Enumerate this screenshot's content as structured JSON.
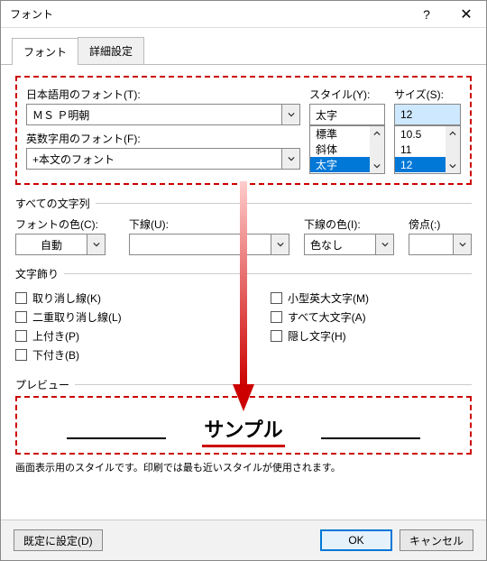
{
  "window": {
    "title": "フォント"
  },
  "tabs": {
    "font": "フォント",
    "advanced": "詳細設定"
  },
  "labels": {
    "jpFont": "日本語用のフォント(T):",
    "enFont": "英数字用のフォント(F):",
    "style": "スタイル(Y):",
    "size": "サイズ(S):"
  },
  "jpFont": {
    "value": "ＭＳ Ｐ明朝"
  },
  "enFont": {
    "value": "+本文のフォント"
  },
  "style": {
    "value": "太字",
    "options": [
      "標準",
      "斜体",
      "太字"
    ],
    "selectedIndex": 2
  },
  "size": {
    "value": "12",
    "options": [
      "10.5",
      "11",
      "12"
    ],
    "selectedIndex": 2
  },
  "allText": {
    "header": "すべての文字列",
    "fontColorLabel": "フォントの色(C):",
    "fontColorValue": "自動",
    "underlineLabel": "下線(U):",
    "underlineValue": "",
    "underlineColorLabel": "下線の色(I):",
    "underlineColorValue": "色なし",
    "emphasisLabel": "傍点(:)"
  },
  "effects": {
    "header": "文字飾り",
    "left": [
      "取り消し線(K)",
      "二重取り消し線(L)",
      "上付き(P)",
      "下付き(B)"
    ],
    "right": [
      "小型英大文字(M)",
      "すべて大文字(A)",
      "隠し文字(H)"
    ]
  },
  "preview": {
    "header": "プレビュー",
    "sample": "サンプル",
    "note": "画面表示用のスタイルです。印刷では最も近いスタイルが使用されます。"
  },
  "buttons": {
    "setDefault": "既定に設定(D)",
    "ok": "OK",
    "cancel": "キャンセル"
  }
}
